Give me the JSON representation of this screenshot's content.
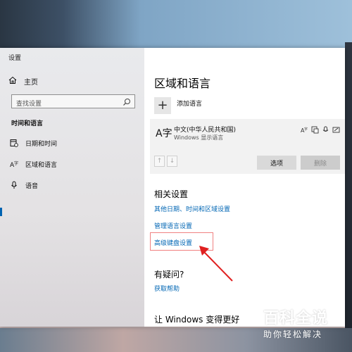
{
  "window": {
    "title": "设置",
    "controls": {
      "minimize": "—",
      "maximize": "☐",
      "close": "✕"
    }
  },
  "nav": {
    "home_label": "主页",
    "search_placeholder": "查找设置",
    "section_heading": "时间和语言",
    "items": [
      {
        "label": "日期和时间",
        "icon": "calendar-clock-icon"
      },
      {
        "label": "区域和语言",
        "icon": "globe-language-icon",
        "active": true
      },
      {
        "label": "语音",
        "icon": "microphone-icon"
      }
    ]
  },
  "main": {
    "title": "区域和语言",
    "add_language_label": "添加语言",
    "language": {
      "name": "中文(中华人民共和国)",
      "subtitle": "Windows 显示语言",
      "glyph": "A字",
      "options_button": "选项",
      "remove_button": "删除"
    },
    "related_heading": "相关设置",
    "related_links": [
      "其他日期、时间和区域设置",
      "管理语言设置",
      "高级键盘设置"
    ],
    "question_heading": "有疑问?",
    "help_link": "获取帮助",
    "improve_heading": "让 Windows 变得更好"
  },
  "watermark": {
    "main": "百科全说",
    "sub": "助你轻松解决"
  },
  "colors": {
    "accent": "#0066b4",
    "highlight": "#f08080",
    "annotation_arrow": "#e02020",
    "watermark_green": "#2e9b3e"
  }
}
